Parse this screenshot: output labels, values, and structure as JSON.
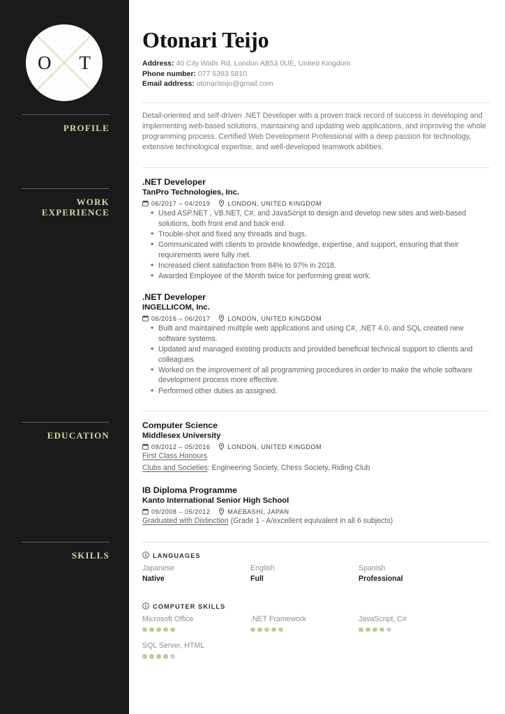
{
  "theme": {
    "sidebar_bg": "#1a1a1a",
    "accent_green": "#cbdba4",
    "dot_filled": "#b6d090",
    "dot_empty": "#cfcfd6",
    "text_dark": "#161616",
    "text_muted": "#6f7478"
  },
  "logo": {
    "initial_left": "O",
    "initial_right": "T",
    "mark": "x-cross-monogram"
  },
  "sidebar": {
    "sections": [
      {
        "label": "PROFILE"
      },
      {
        "label": "WORK\nEXPERIENCE"
      },
      {
        "label": "EDUCATION"
      },
      {
        "label": "SKILLS"
      }
    ],
    "work_line1": "WORK",
    "work_line2": "EXPERIENCE"
  },
  "header": {
    "name": "Otonari Teijo",
    "contacts": [
      {
        "label": "Address:",
        "value": "40 City Walls Rd, London AB53 0UE, United Kingdom"
      },
      {
        "label": "Phone number:",
        "value": "077 5393 5810"
      },
      {
        "label": "Email address:",
        "value": "otonariteijo@gmail.com"
      }
    ]
  },
  "profile": {
    "text": "Detail-oriented and self-driven .NET Developer with a proven track record of success in developing and implementing web-based solutions, maintaining and updating web applications, and improving the whole programming process. Certified Web Development Professional with a deep passion for technology, extensive technological expertise, and well-developed teamwork abilities."
  },
  "work_experience": [
    {
      "title": ".NET Developer",
      "organization": "TanPro Technologies, Inc.",
      "dates": "06/2017 – 04/2019",
      "location": "LONDON, UNITED KINGDOM",
      "bullets": [
        "Used  ASP.NET , VB.NET, C#, and JavaScript to design and develop new sites and web-based solutions, both front end and back end.",
        "Trouble-shot and fixed any threads and bugs.",
        "Communicated with clients to provide knowledge, expertise, and support, ensuring that their requirements were fully met.",
        "Increased client satisfaction from 84% to 97% in 2018.",
        "Awarded Employee of the Month twice for performing great work."
      ]
    },
    {
      "title": ".NET Developer",
      "organization": "INGELLICOM, Inc.",
      "dates": "06/2016 – 06/2017",
      "location": "LONDON, UNITED KINGDOM",
      "bullets": [
        "Built and maintained multiple web applications and using C#, .NET 4.0, and SQL created new software systems.",
        "Updated and managed existing products and provided beneficial technical support to clients and colleagues.",
        "Worked on the improvement of all programming procedures in order to make the whole software development process more effective.",
        "Performed other duties as assigned."
      ]
    }
  ],
  "education": [
    {
      "title": "Computer Science",
      "organization": "Middlesex University",
      "dates": "09/2012 – 05/2016",
      "location": "LONDON, UNITED KINGDOM",
      "note_underlined_1": "First Class Honours",
      "note_underlined_2": "Clubs and Societies",
      "note_plain_2": ": Engineering Society, Chess Society, Riding Club"
    },
    {
      "title": "IB Diploma Programme",
      "organization": "Kanto International Senior High School",
      "dates": "09/2008 – 05/2012",
      "location": "MAEBASHI, JAPAN",
      "note_underlined_1": "Graduated with Distinction",
      "note_plain_1": " (Grade 1 - A/excellent equivalent in all 6 subjects)"
    }
  ],
  "skills": {
    "languages_heading": "LANGUAGES",
    "languages": [
      {
        "name": "Japanese",
        "level": "Native"
      },
      {
        "name": "English",
        "level": "Full"
      },
      {
        "name": "Spanish",
        "level": "Professional"
      }
    ],
    "computer_heading": "COMPUTER SKILLS",
    "computer": [
      {
        "name": "Microsoft Office",
        "rating": 5,
        "max": 5
      },
      {
        "name": ".NET Framework",
        "rating": 5,
        "max": 5
      },
      {
        "name": "JavaScript, C#",
        "rating": 4,
        "max": 5
      },
      {
        "name": "SQL Server, HTML",
        "rating": 4,
        "max": 5
      }
    ]
  }
}
